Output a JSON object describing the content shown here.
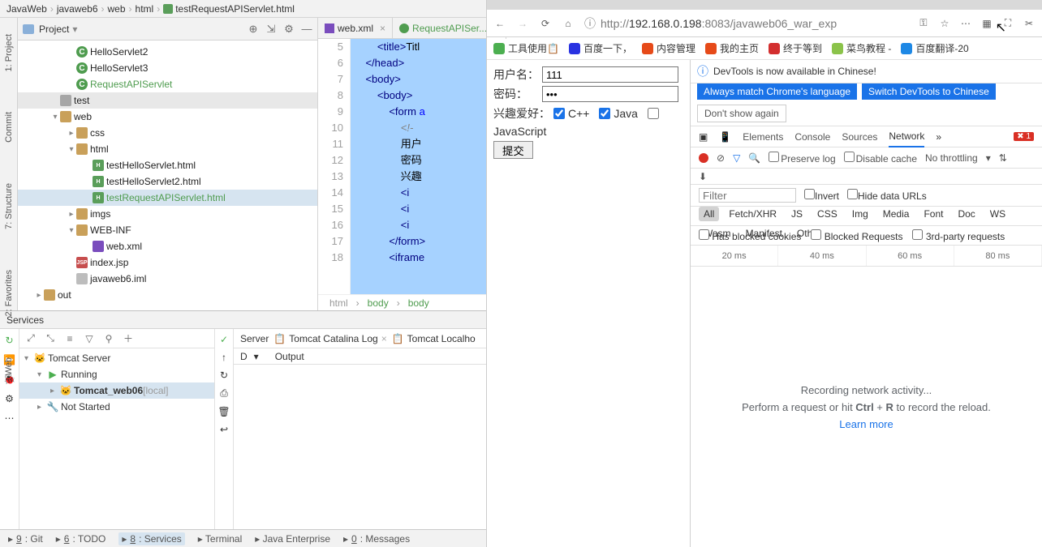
{
  "breadcrumb": [
    "JavaWeb",
    "javaweb6",
    "web",
    "html",
    "testRequestAPIServlet.html"
  ],
  "sidebar_left": {
    "project": "1: Project",
    "commit": "Commit",
    "structure": "7: Structure",
    "favorites": "2: Favorites",
    "web": "Web"
  },
  "project_panel": {
    "title": "Project",
    "tree": [
      {
        "pad": 60,
        "exp": "",
        "ico": "class-c",
        "icoTxt": "C",
        "lbl": "HelloServlet2",
        "cls": ""
      },
      {
        "pad": 60,
        "exp": "",
        "ico": "class-c",
        "icoTxt": "C",
        "lbl": "HelloServlet3",
        "cls": ""
      },
      {
        "pad": 60,
        "exp": "",
        "ico": "class-c",
        "icoTxt": "C",
        "lbl": "RequestAPIServlet",
        "cls": "green"
      },
      {
        "pad": 40,
        "exp": "",
        "ico": "folder-gray",
        "icoTxt": "",
        "lbl": "test",
        "cls": "",
        "row": "hl"
      },
      {
        "pad": 40,
        "exp": "▾",
        "ico": "folder",
        "icoTxt": "",
        "lbl": "web",
        "cls": ""
      },
      {
        "pad": 60,
        "exp": "▸",
        "ico": "folder",
        "icoTxt": "",
        "lbl": "css",
        "cls": ""
      },
      {
        "pad": 60,
        "exp": "▾",
        "ico": "folder",
        "icoTxt": "",
        "lbl": "html",
        "cls": ""
      },
      {
        "pad": 80,
        "exp": "",
        "ico": "html",
        "icoTxt": "H",
        "lbl": "testHelloServlet.html",
        "cls": ""
      },
      {
        "pad": 80,
        "exp": "",
        "ico": "html",
        "icoTxt": "H",
        "lbl": "testHelloServlet2.html",
        "cls": ""
      },
      {
        "pad": 80,
        "exp": "",
        "ico": "html",
        "icoTxt": "H",
        "lbl": "testRequestAPIServlet.html",
        "cls": "green",
        "row": "sel"
      },
      {
        "pad": 60,
        "exp": "▸",
        "ico": "folder",
        "icoTxt": "",
        "lbl": "imgs",
        "cls": ""
      },
      {
        "pad": 60,
        "exp": "▾",
        "ico": "folder",
        "icoTxt": "",
        "lbl": "WEB-INF",
        "cls": ""
      },
      {
        "pad": 80,
        "exp": "",
        "ico": "xml",
        "icoTxt": "",
        "lbl": "web.xml",
        "cls": ""
      },
      {
        "pad": 60,
        "exp": "",
        "ico": "jsp",
        "icoTxt": "JSP",
        "lbl": "index.jsp",
        "cls": ""
      },
      {
        "pad": 60,
        "exp": "",
        "ico": "iml",
        "icoTxt": "",
        "lbl": "javaweb6.iml",
        "cls": ""
      },
      {
        "pad": 20,
        "exp": "▸",
        "ico": "folder",
        "icoTxt": "",
        "lbl": "out",
        "cls": ""
      }
    ]
  },
  "editor_tabs": [
    {
      "ico": "xml",
      "lbl": "web.xml",
      "cls": ""
    },
    {
      "ico": "class-c",
      "lbl": "RequestAPISer...",
      "cls": "green"
    }
  ],
  "gutter_lines": [
    "5",
    "6",
    "7",
    "8",
    "9",
    "10",
    "11",
    "12",
    "13",
    "14",
    "15",
    "16",
    "17",
    "18"
  ],
  "code_lines": [
    "        <span class='t-tag'>&lt;title&gt;</span><span class='t-txt'>Titl</span>",
    "    <span class='t-tag'>&lt;/head&gt;</span>",
    "    <span class='t-tag'>&lt;body&gt;</span>",
    "        <span class='t-tag'>&lt;body&gt;</span>",
    "            <span class='t-tag'>&lt;form </span><span class='t-key'>a</span>",
    "                <span class='t-comm'>&lt;!-</span>",
    "                <span class='t-txt'>用户</span>",
    "                <span class='t-txt'>密码</span>",
    "                <span class='t-txt'>兴趣</span>",
    "                <span class='t-tag'>&lt;i</span>",
    "                <span class='t-tag'>&lt;i</span>",
    "                <span class='t-tag'>&lt;i</span>",
    "            <span class='t-tag'>&lt;/form&gt;</span>",
    "            <span class='t-tag'>&lt;iframe</span>"
  ],
  "editor_status": [
    "html",
    "body",
    "body"
  ],
  "services": {
    "title": "Services",
    "output_tabs": [
      "Server",
      "Tomcat Catalina Log",
      "Tomcat Localho"
    ],
    "output_cols": [
      "D",
      "Output"
    ],
    "tree": [
      {
        "pad": 0,
        "exp": "▾",
        "ico": "🐱",
        "lbl": "Tomcat Server",
        "cls": ""
      },
      {
        "pad": 16,
        "exp": "▾",
        "ico": "▶",
        "icoColor": "#4caf50",
        "lbl": "Running",
        "cls": ""
      },
      {
        "pad": 32,
        "exp": "▸",
        "ico": "🐱",
        "lbl": "Tomcat_web06",
        "suffix": " [local]",
        "cls": "bold",
        "row": "sel"
      },
      {
        "pad": 16,
        "exp": "▸",
        "ico": "🔧",
        "lbl": "Not Started",
        "cls": ""
      }
    ]
  },
  "statusbar": {
    "items": [
      {
        "key": "git",
        "lbl": "9: Git"
      },
      {
        "key": "todo",
        "lbl": "6: TODO"
      },
      {
        "key": "services",
        "lbl": "8: Services",
        "active": true
      },
      {
        "key": "terminal",
        "lbl": "Terminal"
      },
      {
        "key": "jee",
        "lbl": "Java Enterprise"
      },
      {
        "key": "messages",
        "lbl": "0: Messages"
      }
    ]
  },
  "browser": {
    "url_prefix": "http://",
    "url_host": "192.168.0.198",
    "url_suffix": ":8083/javaweb06_war_exp",
    "page": {
      "username_lbl": "用户名：",
      "username_val": "111",
      "password_lbl": "密码：",
      "password_val": "•••",
      "hobby_lbl": "兴趣爱好：",
      "cpp": "C++",
      "java": "Java",
      "js": "JavaScript",
      "submit": "提交"
    },
    "bookmarks": [
      "工具使用📋",
      "百度一下，",
      "内容管理",
      "我的主页",
      "终于等到",
      "菜鸟教程 -",
      "百度翻译-20"
    ]
  },
  "devtools": {
    "banner_msg": "DevTools is now available in Chinese!",
    "btn1": "Always match Chrome's language",
    "btn2": "Switch DevTools to Chinese",
    "btn3": "Don't show again",
    "tabs": [
      "Elements",
      "Console",
      "Sources",
      "Network"
    ],
    "warn_count": "1",
    "sub": {
      "preserve": "Preserve log",
      "cache": "Disable cache",
      "throttle": "No throttling"
    },
    "filter": {
      "placeholder": "Filter",
      "invert": "Invert",
      "hide": "Hide data URLs"
    },
    "types": [
      "All",
      "Fetch/XHR",
      "JS",
      "CSS",
      "Img",
      "Media",
      "Font",
      "Doc",
      "WS",
      "Wasm",
      "Manifest",
      "Other"
    ],
    "checks": [
      "Has blocked cookies",
      "Blocked Requests",
      "3rd-party requests"
    ],
    "timeline": [
      "20 ms",
      "40 ms",
      "60 ms",
      "80 ms"
    ],
    "empty1": "Recording network activity...",
    "empty2_a": "Perform a request or hit ",
    "empty2_b": "Ctrl",
    "empty2_c": " + ",
    "empty2_d": "R",
    "empty2_e": " to record the reload.",
    "learn": "Learn more"
  }
}
